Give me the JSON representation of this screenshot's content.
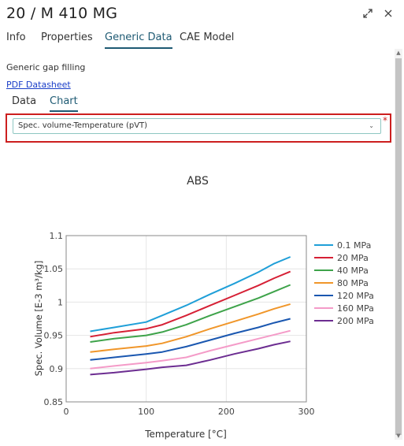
{
  "window": {
    "title": "20 / M 410 MG",
    "expand_icon": "expand-icon",
    "close_icon": "close-icon"
  },
  "tabs": [
    {
      "label": "Info",
      "active": false
    },
    {
      "label": "Properties",
      "active": false
    },
    {
      "label": "Generic Data",
      "active": true
    },
    {
      "label": "CAE Model",
      "active": false
    }
  ],
  "generic": {
    "description": "Generic gap filling",
    "datasheet_link": "PDF Datasheet"
  },
  "subtabs": [
    {
      "label": "Data",
      "active": false
    },
    {
      "label": "Chart",
      "active": true
    }
  ],
  "select": {
    "value": "Spec. volume-Temperature (pVT)",
    "required_mark": "*"
  },
  "chart_data": {
    "type": "line",
    "title": "ABS",
    "xlabel": "Temperature [°C]",
    "ylabel": "Spec. Volume [E-3 m³/kg]",
    "xlim": [
      0,
      300
    ],
    "ylim": [
      0.85,
      1.1
    ],
    "xticks": [
      0,
      100,
      200,
      300
    ],
    "yticks": [
      0.85,
      0.9,
      0.95,
      1,
      1.05,
      1.1
    ],
    "ytick_labels": [
      "0.85",
      "0.9",
      "0.95",
      "1",
      "1.05",
      "1.1"
    ],
    "grid": true,
    "legend_position": "right",
    "series": [
      {
        "name": "0.1 MPa",
        "color": "#1f9fd8",
        "x": [
          30,
          60,
          100,
          120,
          150,
          180,
          210,
          240,
          260,
          280
        ],
        "y": [
          0.956,
          0.962,
          0.97,
          0.98,
          0.995,
          1.012,
          1.028,
          1.045,
          1.058,
          1.068
        ]
      },
      {
        "name": "20 MPa",
        "color": "#d62035",
        "x": [
          30,
          60,
          100,
          120,
          150,
          180,
          210,
          240,
          260,
          280
        ],
        "y": [
          0.948,
          0.954,
          0.96,
          0.966,
          0.98,
          0.995,
          1.01,
          1.025,
          1.036,
          1.046
        ]
      },
      {
        "name": "40 MPa",
        "color": "#3ea34a",
        "x": [
          30,
          60,
          100,
          120,
          150,
          180,
          210,
          240,
          260,
          280
        ],
        "y": [
          0.94,
          0.945,
          0.95,
          0.955,
          0.966,
          0.98,
          0.993,
          1.006,
          1.016,
          1.026
        ]
      },
      {
        "name": "80 MPa",
        "color": "#f0962a",
        "x": [
          30,
          60,
          100,
          120,
          150,
          180,
          210,
          240,
          260,
          280
        ],
        "y": [
          0.925,
          0.929,
          0.934,
          0.938,
          0.948,
          0.96,
          0.971,
          0.982,
          0.99,
          0.997
        ]
      },
      {
        "name": "120 MPa",
        "color": "#1a57b0",
        "x": [
          30,
          60,
          100,
          120,
          150,
          180,
          210,
          240,
          260,
          280
        ],
        "y": [
          0.913,
          0.917,
          0.922,
          0.925,
          0.933,
          0.943,
          0.953,
          0.962,
          0.969,
          0.975
        ]
      },
      {
        "name": "160 MPa",
        "color": "#f49bc8",
        "x": [
          30,
          60,
          100,
          120,
          150,
          180,
          210,
          240,
          260,
          280
        ],
        "y": [
          0.9,
          0.904,
          0.909,
          0.912,
          0.917,
          0.927,
          0.936,
          0.945,
          0.951,
          0.957
        ]
      },
      {
        "name": "200 MPa",
        "color": "#6c2d91",
        "x": [
          30,
          60,
          100,
          120,
          150,
          180,
          210,
          240,
          260,
          280
        ],
        "y": [
          0.891,
          0.894,
          0.899,
          0.902,
          0.905,
          0.913,
          0.922,
          0.93,
          0.936,
          0.941
        ]
      }
    ]
  }
}
